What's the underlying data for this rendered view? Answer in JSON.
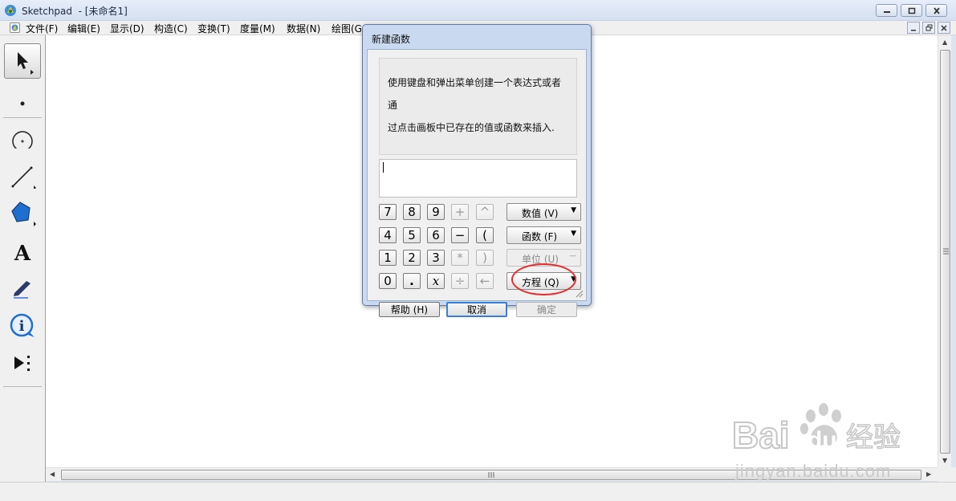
{
  "window": {
    "title": "Sketchpad  - [未命名1]"
  },
  "menu": [
    {
      "label": "文件(F)"
    },
    {
      "label": "编辑(E)"
    },
    {
      "label": "显示(D)"
    },
    {
      "label": "构造(C)"
    },
    {
      "label": "变换(T)"
    },
    {
      "label": "度量(M)"
    },
    {
      "label": "数据(N)"
    },
    {
      "label": "绘图(G"
    }
  ],
  "toolbar": {
    "tools": [
      {
        "name": "arrow-tool",
        "icon": "arrow-icon",
        "selected": true
      },
      {
        "name": "point-tool",
        "icon": "point-icon"
      },
      {
        "name": "compass-tool",
        "icon": "circle-icon"
      },
      {
        "name": "straightedge-tool",
        "icon": "segment-icon"
      },
      {
        "name": "polygon-tool",
        "icon": "polygon-icon"
      },
      {
        "name": "text-tool",
        "icon": "text-icon",
        "label": "A"
      },
      {
        "name": "marker-tool",
        "icon": "pen-icon"
      },
      {
        "name": "information-tool",
        "icon": "info-icon"
      },
      {
        "name": "custom-tool",
        "icon": "custom-tool-icon"
      }
    ]
  },
  "dialog": {
    "title": "新建函数",
    "instruction_line1": "使用键盘和弹出菜单创建一个表达式或者通",
    "instruction_line2": "过点击画板中已存在的值或函数来插入.",
    "expression_value": "",
    "keypad": {
      "rows": [
        [
          "7",
          "8",
          "9",
          "+",
          "^"
        ],
        [
          "4",
          "5",
          "6",
          "−",
          "("
        ],
        [
          "1",
          "2",
          "3",
          "*",
          ")"
        ],
        [
          "0",
          ".",
          "x",
          "÷",
          "←"
        ]
      ]
    },
    "dropdowns": {
      "value": "数值 (V)",
      "function": "函数 (F)",
      "unit": "单位 (U)",
      "equation": "方程 (Q)"
    },
    "buttons": {
      "help": "帮助 (H)",
      "cancel": "取消",
      "ok": "确定"
    }
  },
  "watermark": {
    "logo_bai": "Bai",
    "logo_du": "du",
    "logo_cn": "经验",
    "url": "jingyan.baidu.com"
  },
  "colors": {
    "annotation_circle": "#e52b2b",
    "dialog_frame": "#c9daf0",
    "canvas": "#ffffff"
  }
}
